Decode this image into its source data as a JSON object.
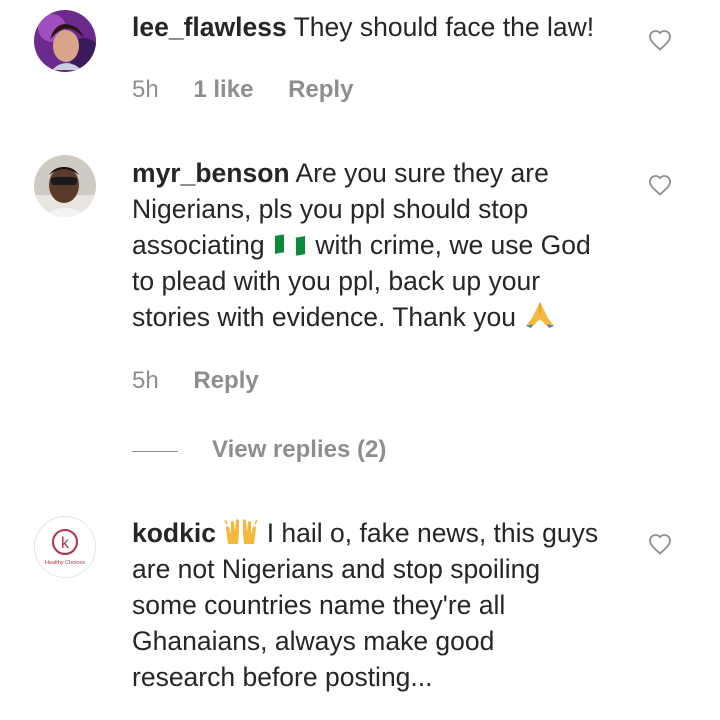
{
  "comments": [
    {
      "username": "lee_flawless",
      "text": "They should face the law!",
      "time": "5h",
      "likes": "1 like",
      "reply": "Reply"
    },
    {
      "username": "myr_benson",
      "text_lines": [
        "Are you sure they are",
        "Nigerians, pls you ppl should stop",
        "associating",
        "with crime, we use God",
        "to plead with you ppl, back up your",
        "stories with evidence. Thank you"
      ],
      "time": "5h",
      "reply": "Reply",
      "view_replies": "View replies (2)"
    },
    {
      "username": "kodkic",
      "avatar_caption": "Healthy Choices",
      "avatar_letter": "k",
      "text_lines": [
        "I hail o, fake news, this guys",
        "are not Nigerians and stop spoiling",
        "some countries name they're all",
        "Ghanaians, always make good",
        "research before posting..."
      ]
    }
  ],
  "icons": {
    "like": "heart-outline-icon",
    "flag": "nigeria-flag-emoji",
    "pray": "folded-hands-emoji",
    "raise": "raising-hands-emoji"
  },
  "colors": {
    "text": "#262626",
    "meta": "#8e8e8e",
    "kodkic_brand": "#b0324a"
  }
}
